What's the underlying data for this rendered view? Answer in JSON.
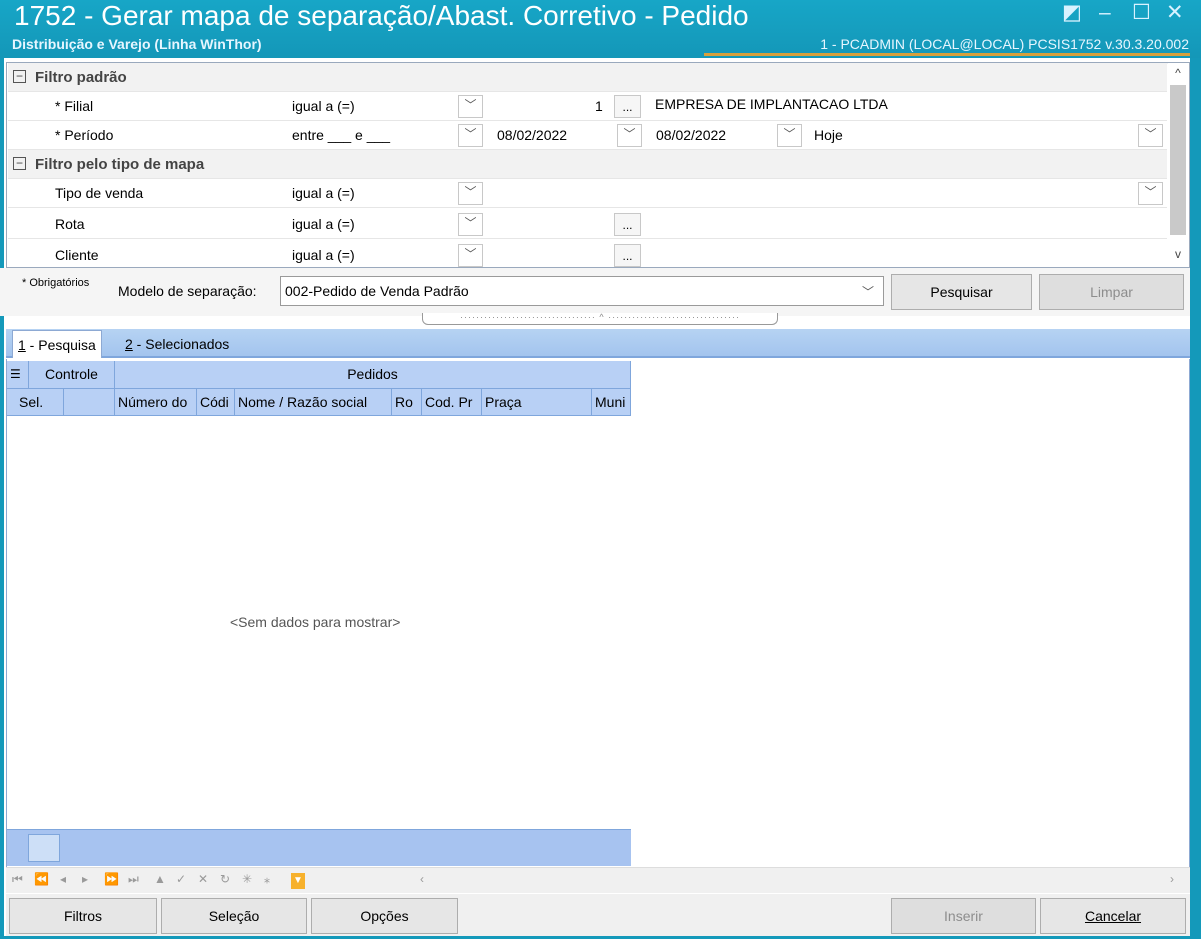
{
  "window": {
    "title": "1752 - Gerar mapa de separação/Abast. Corretivo - Pedido",
    "subtitle": "Distribuição e Varejo (Linha WinThor)",
    "user_info": "1 - PCADMIN (LOCAL@LOCAL)   PCSIS1752  v.30.3.20.002"
  },
  "filters": {
    "group_default": "Filtro padrão",
    "group_map_type": "Filtro pelo tipo de mapa",
    "filial": {
      "label": "* Filial",
      "operator": "igual a (=)",
      "code": "1",
      "name": "EMPRESA DE IMPLANTACAO LTDA"
    },
    "periodo": {
      "label": "* Período",
      "operator": "entre ___ e ___",
      "start": "08/02/2022",
      "end": "08/02/2022",
      "preset": "Hoje"
    },
    "tipo_venda": {
      "label": "Tipo de venda",
      "operator": "igual a (=)"
    },
    "rota": {
      "label": "Rota",
      "operator": "igual a (=)"
    },
    "cliente": {
      "label": "Cliente",
      "operator": "igual a (=)"
    },
    "ellipsis": "..."
  },
  "model": {
    "required_note": "* Obrigatórios",
    "label": "Modelo de separação:",
    "value": "002-Pedido de Venda Padrão",
    "search_button": "Pesquisar",
    "clear_button": "Limpar"
  },
  "tabs": [
    {
      "hotkey": "1",
      "label": " - Pesquisa"
    },
    {
      "hotkey": "2",
      "label": " - Selecionados"
    }
  ],
  "grid": {
    "band_headers": [
      "Controle",
      "Pedidos"
    ],
    "columns": [
      "Sel.",
      "",
      "Número do",
      "Códi",
      "Nome / Razão social",
      "Ro",
      "Cod. Pr",
      "Praça",
      "Muni"
    ],
    "empty_text": "<Sem dados para mostrar>"
  },
  "bottom_buttons": {
    "filtros": "Filtros",
    "selecao": "Seleção",
    "opcoes": "Opções",
    "inserir": "Inserir",
    "cancelar": "Cancelar"
  },
  "colors": {
    "titlebar": "#17a6c7",
    "grid_header": "#b8d0f5",
    "accent": "#d7a03c"
  }
}
